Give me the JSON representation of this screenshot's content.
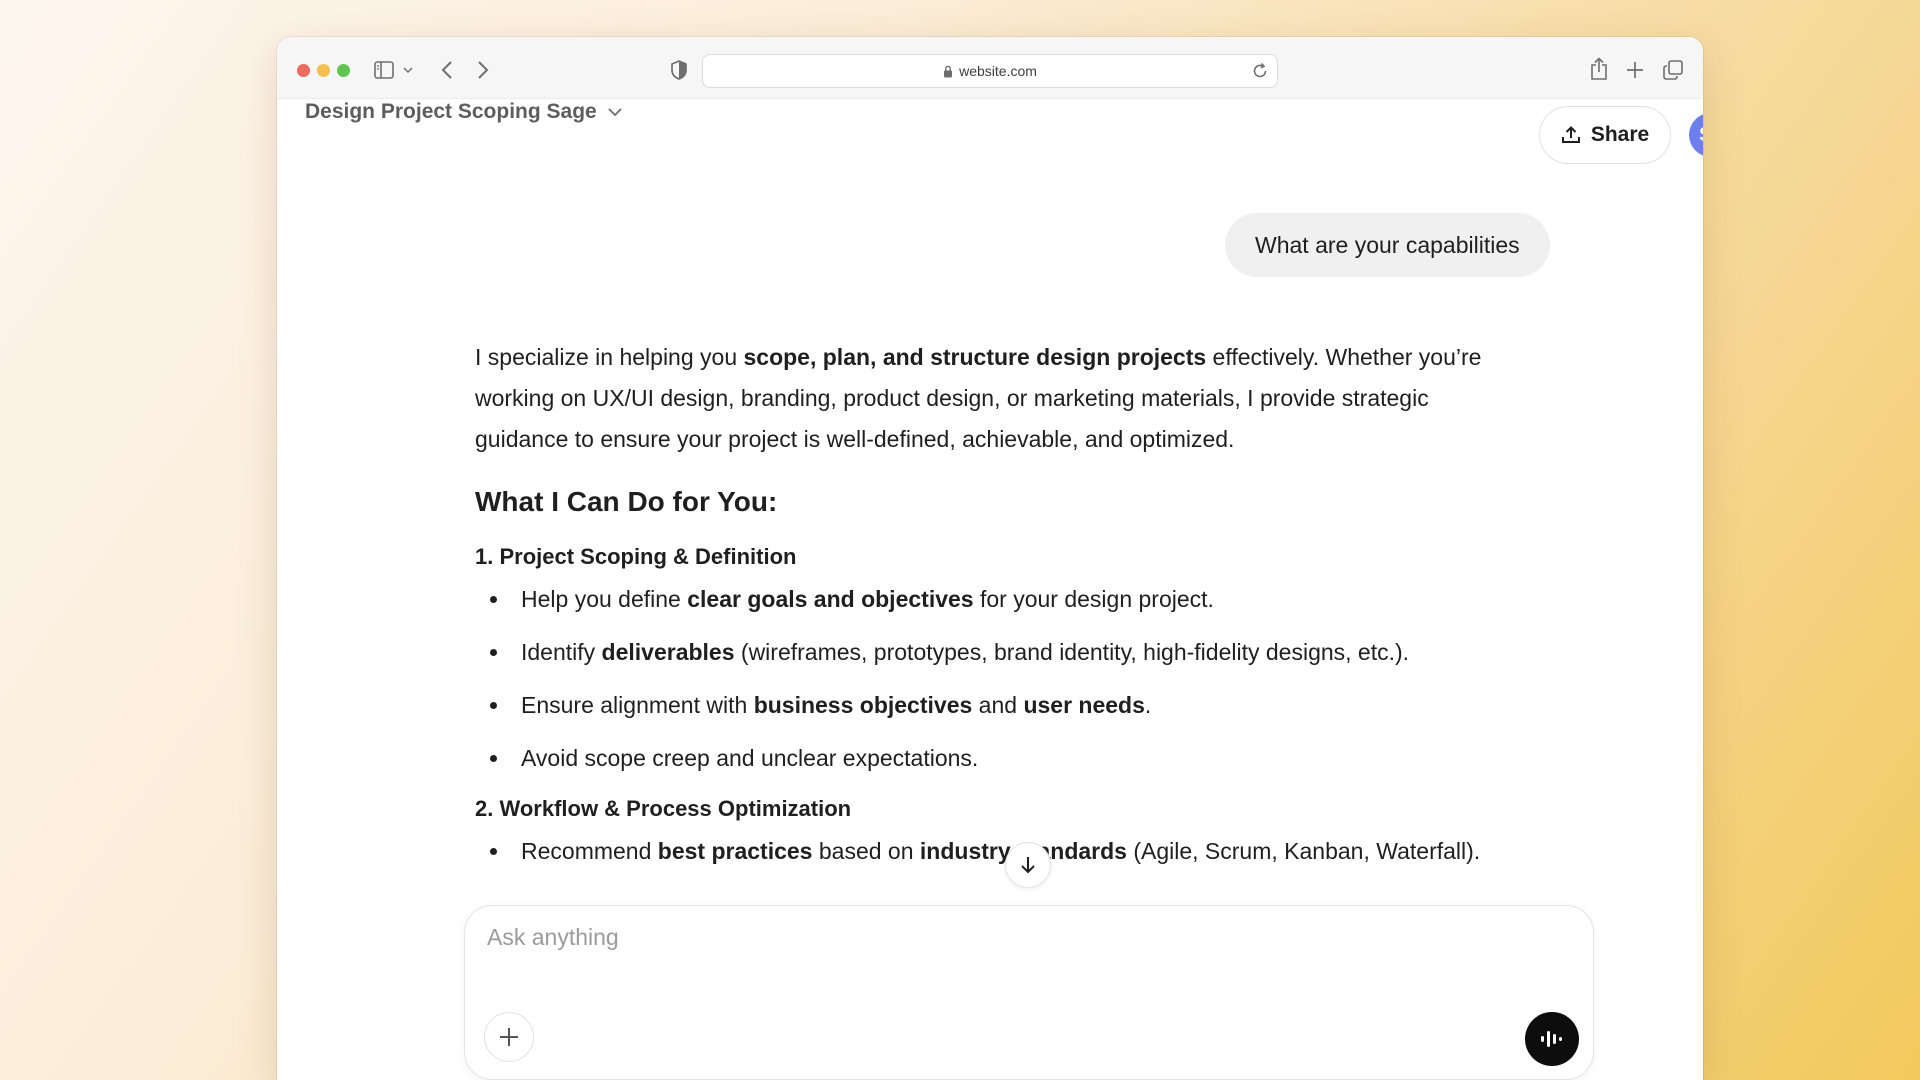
{
  "browser": {
    "url": "website.com"
  },
  "header": {
    "title": "Design Project Scoping Sage",
    "share_label": "Share",
    "avatar_initial": "S"
  },
  "conversation": {
    "user_message": "What are your capabilities",
    "intro": {
      "part1": "I specialize in helping you ",
      "bold1": "scope, plan, and structure design projects",
      "part2": " effectively. Whether you’re working on UX/UI design, branding, product design, or marketing materials, I provide strategic guidance to ensure your project is well-defined, achievable, and optimized."
    },
    "heading": "What I Can Do for You:",
    "section1": {
      "title": "1. Project Scoping & Definition",
      "item1": {
        "a": "Help you define ",
        "b": "clear goals and objectives",
        "c": " for your design project."
      },
      "item2": {
        "a": "Identify ",
        "b": "deliverables",
        "c": " (wireframes, prototypes, brand identity, high-fidelity designs, etc.)."
      },
      "item3": {
        "a": "Ensure alignment with ",
        "b": "business objectives",
        "c": " and ",
        "d": "user needs",
        "e": "."
      },
      "item4": {
        "a": "Avoid scope creep and unclear expectations."
      }
    },
    "section2": {
      "title": "2. Workflow & Process Optimization",
      "item1": {
        "a": "Recommend ",
        "b": "best practices",
        "c": " based on ",
        "d": "industry standards",
        "e": " (Agile, Scrum, Kanban, Waterfall)."
      }
    }
  },
  "composer": {
    "placeholder": "Ask anything"
  },
  "colors": {
    "accent_avatar": "#6d7ff0",
    "voice_button": "#0d0d0d"
  }
}
